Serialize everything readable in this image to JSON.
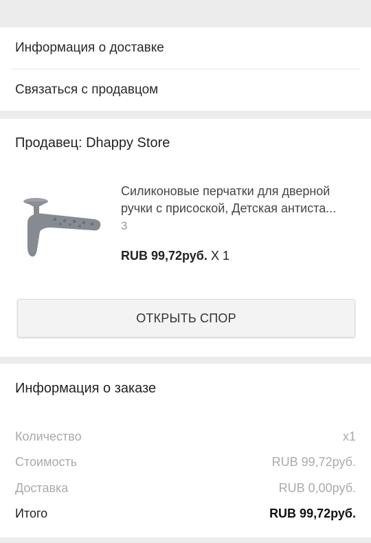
{
  "links": {
    "delivery_info": "Информация о доставке",
    "contact_seller": "Связаться с продавцом"
  },
  "seller": {
    "label": "Продавец: Dhappy Store"
  },
  "product": {
    "title_line1": "Силиконовые перчатки для дверной",
    "title_line2": "ручки с присоской, Детская антиста...",
    "sku": "3",
    "price": "RUB 99,72руб.",
    "qty": "X 1",
    "image_icon": "silicone-door-handle-glove-image"
  },
  "actions": {
    "open_dispute": "ОТКРЫТЬ СПОР"
  },
  "order": {
    "title": "Информация о заказе",
    "rows": [
      {
        "label": "Количество",
        "value": "x1"
      },
      {
        "label": "Стоимость",
        "value": "RUB 99,72руб."
      },
      {
        "label": "Доставка",
        "value": "RUB 0,00руб."
      },
      {
        "label": "Итого",
        "value": "RUB 99,72руб."
      }
    ]
  },
  "colors": {
    "background": "#ececec",
    "card": "#ffffff",
    "muted_text": "#aaaaaa",
    "product_gray": "#8a8f96"
  }
}
